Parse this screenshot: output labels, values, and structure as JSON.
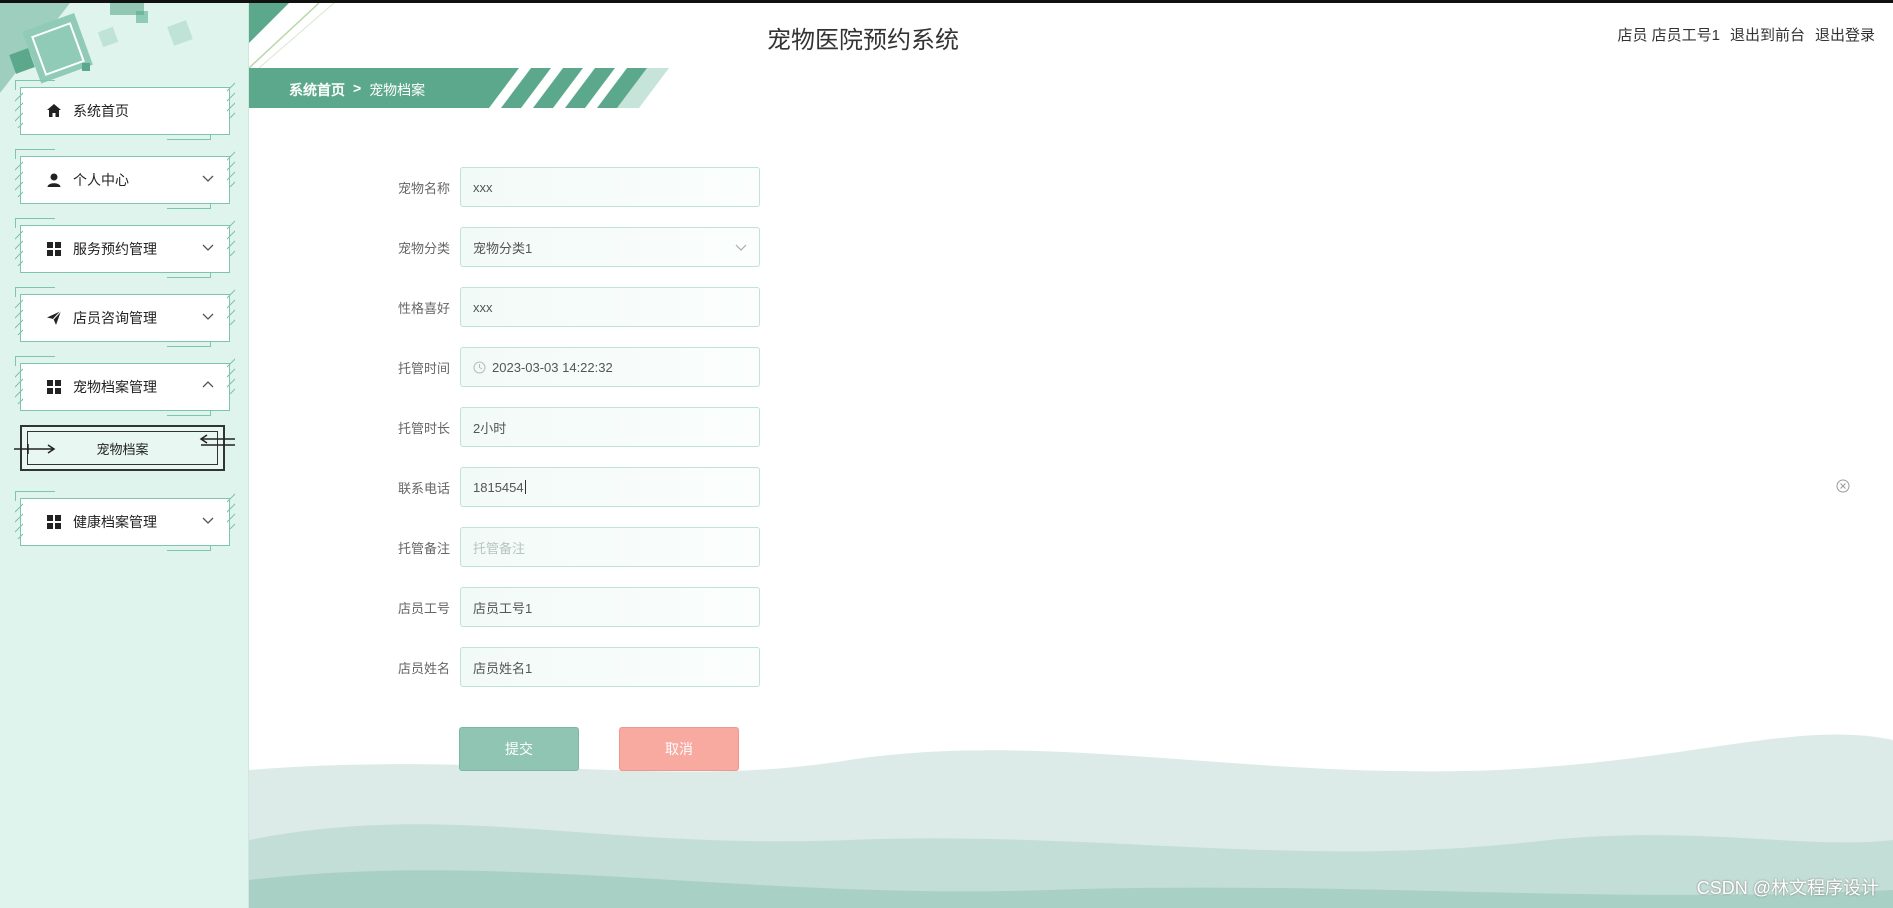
{
  "app": {
    "title": "宠物医院预约系统"
  },
  "header": {
    "user_label": "店员 店员工号1",
    "front_link": "退出到前台",
    "logout_link": "退出登录"
  },
  "breadcrumb": {
    "home": "系统首页",
    "separator": ">",
    "current": "宠物档案"
  },
  "sidebar": {
    "items": [
      {
        "label": "系统首页",
        "icon": "home-icon"
      },
      {
        "label": "个人中心",
        "icon": "user-icon"
      },
      {
        "label": "服务预约管理",
        "icon": "grid-icon"
      },
      {
        "label": "店员咨询管理",
        "icon": "send-icon"
      },
      {
        "label": "宠物档案管理",
        "icon": "grid-icon"
      },
      {
        "label": "健康档案管理",
        "icon": "grid-icon"
      }
    ],
    "submenu": {
      "label": "宠物档案"
    }
  },
  "form": {
    "fields": [
      {
        "label": "宠物名称",
        "value": "xxx",
        "placeholder": ""
      },
      {
        "label": "宠物分类",
        "value": "宠物分类1",
        "placeholder": ""
      },
      {
        "label": "性格喜好",
        "value": "xxx",
        "placeholder": ""
      },
      {
        "label": "托管时间",
        "value": "2023-03-03 14:22:32",
        "placeholder": ""
      },
      {
        "label": "托管时长",
        "value": "2小时",
        "placeholder": ""
      },
      {
        "label": "联系电话",
        "value": "1815454",
        "placeholder": ""
      },
      {
        "label": "托管备注",
        "value": "",
        "placeholder": "托管备注"
      },
      {
        "label": "店员工号",
        "value": "店员工号1",
        "placeholder": ""
      },
      {
        "label": "店员姓名",
        "value": "店员姓名1",
        "placeholder": ""
      }
    ],
    "submit_label": "提交",
    "cancel_label": "取消"
  },
  "watermark": "CSDN @林文程序设计",
  "colors": {
    "accent": "#5ba88c",
    "sidebar_bg": "#e0f4ee",
    "submit": "#8fc5b2",
    "cancel": "#f8a9a0"
  }
}
